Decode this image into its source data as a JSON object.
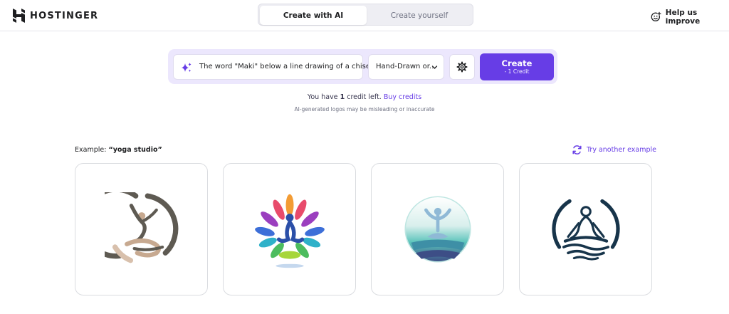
{
  "brand": {
    "name": "HOSTINGER"
  },
  "tabs": [
    {
      "label": "Create with AI",
      "active": true
    },
    {
      "label": "Create yourself",
      "active": false
    }
  ],
  "help": {
    "label": "Help us improve",
    "icon": "smiley-plus-icon"
  },
  "prompt": {
    "value": "The word \"Maki\" below a line drawing of a chisel",
    "icon": "sparkle-icon"
  },
  "style_select": {
    "value": "Hand-Drawn or..."
  },
  "settings": {
    "icon": "gear-icon"
  },
  "create_button": {
    "label": "Create",
    "sub_label": "- 1 Credit"
  },
  "credits": {
    "prefix": "You have",
    "count": "1",
    "suffix": "credit left.",
    "buy_label": "Buy credits"
  },
  "disclaimer": "AI-generated logos may be misleading or inaccurate",
  "example": {
    "prefix": "Example:",
    "term": "“yoga studio”",
    "try_label": "Try another example"
  },
  "logos": [
    {
      "name": "yoga-logo-brown-circle"
    },
    {
      "name": "yoga-logo-colorful-lotus"
    },
    {
      "name": "yoga-logo-teal-circle"
    },
    {
      "name": "yoga-logo-navy-meditation"
    }
  ],
  "colors": {
    "accent": "#673de6",
    "accent_light": "#ece7fd"
  }
}
